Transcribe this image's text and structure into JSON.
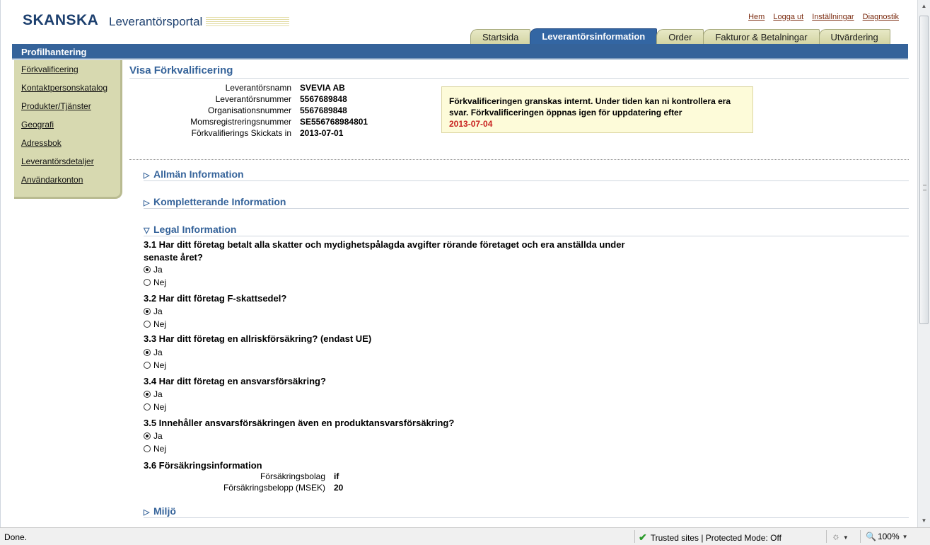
{
  "header": {
    "logo": "SKANSKA",
    "portal_title": "Leverantörsportal",
    "global_links": [
      "Hem",
      "Logga ut",
      "Inställningar",
      "Diagnostik"
    ]
  },
  "tabs": [
    {
      "label": "Startsida",
      "active": false
    },
    {
      "label": "Leverantörsinformation",
      "active": true
    },
    {
      "label": "Order",
      "active": false
    },
    {
      "label": "Fakturor & Betalningar",
      "active": false
    },
    {
      "label": "Utvärdering",
      "active": false
    }
  ],
  "nav_bar": {
    "title": "Profilhantering"
  },
  "sidebar": {
    "items": [
      {
        "label": "Förkvalificering"
      },
      {
        "label": "Kontaktpersonskatalog"
      },
      {
        "label": "Produkter/Tjänster"
      },
      {
        "label": "Geografi"
      },
      {
        "label": "Adressbok"
      },
      {
        "label": "Leverantörsdetaljer"
      },
      {
        "label": "Användarkonton"
      }
    ]
  },
  "page": {
    "heading": "Visa Förkvalificering",
    "supplier": [
      {
        "label": "Leverantörsnamn",
        "value": "SVEVIA AB"
      },
      {
        "label": "Leverantörsnummer",
        "value": "5567689848"
      },
      {
        "label": "Organisationsnummer",
        "value": "5567689848"
      },
      {
        "label": "Momsregistreringsnummer",
        "value": "SE556768984801"
      },
      {
        "label": "Förkvalifierings Skickats in",
        "value": "2013-07-01"
      }
    ],
    "notice": {
      "text": "Förkvalificeringen granskas internt. Under tiden kan ni kontrollera era svar. Förkvalificeringen öppnas igen för uppdatering efter",
      "date": "2013-07-04"
    },
    "sections": {
      "general": "Allmän Information",
      "complementary": "Kompletterande Information",
      "legal": "Legal Information",
      "environment": "Miljö"
    },
    "questions": [
      {
        "text": "3.1 Har ditt företag betalt alla skatter och mydighetspålagda avgifter rörande företaget och era anställda under senaste året?",
        "yes": "Ja",
        "no": "Nej",
        "selected": "Ja"
      },
      {
        "text": "3.2 Har ditt företag F-skattsedel?",
        "yes": "Ja",
        "no": "Nej",
        "selected": "Ja"
      },
      {
        "text": "3.3 Har ditt företag en allriskförsäkring? (endast UE)",
        "yes": "Ja",
        "no": "Nej",
        "selected": "Ja"
      },
      {
        "text": "3.4 Har ditt företag en ansvarsförsäkring?",
        "yes": "Ja",
        "no": "Nej",
        "selected": "Ja"
      },
      {
        "text": "3.5 Innehåller ansvarsförsäkringen även en produktansvarsförsäkring?",
        "yes": "Ja",
        "no": "Nej",
        "selected": "Ja"
      }
    ],
    "insurance": {
      "heading": "3.6 Försäkringsinformation",
      "company_label": "Försäkringsbolag",
      "company_value": "if",
      "amount_label": "Försäkringsbelopp (MSEK)",
      "amount_value": "20"
    }
  },
  "statusbar": {
    "status": "Done.",
    "zone": "Trusted sites | Protected Mode: Off",
    "zoom": "100%"
  },
  "colors": {
    "brand_blue": "#35639a",
    "tab_khaki": "#d7d9b0",
    "link_brown": "#7a2a0e",
    "notice_date": "#c8201f"
  }
}
